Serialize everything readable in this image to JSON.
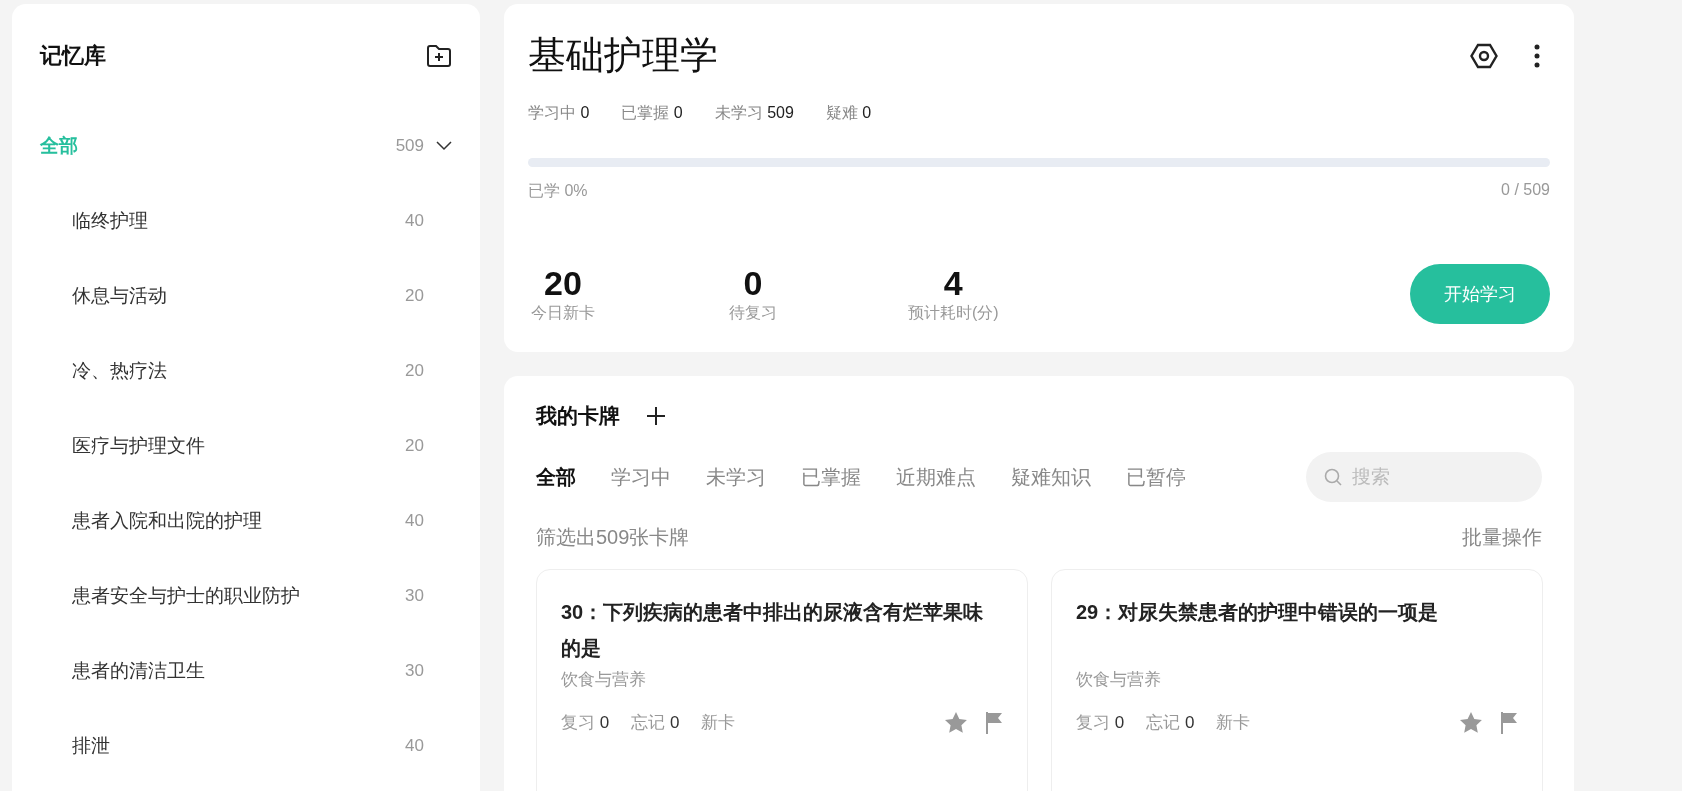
{
  "sidebar": {
    "title": "记忆库",
    "root": {
      "label": "全部",
      "count": "509",
      "selected": true,
      "expanded": true,
      "children": [
        {
          "label": "临终护理",
          "count": "40",
          "selected": false
        },
        {
          "label": "休息与活动",
          "count": "20",
          "selected": false
        },
        {
          "label": "冷、热疗法",
          "count": "20",
          "selected": false
        },
        {
          "label": "医疗与护理文件",
          "count": "20",
          "selected": false
        },
        {
          "label": "患者入院和出院的护理",
          "count": "40",
          "selected": false
        },
        {
          "label": "患者安全与护士的职业防护",
          "count": "30",
          "selected": false
        },
        {
          "label": "患者的清洁卫生",
          "count": "30",
          "selected": false
        },
        {
          "label": "排泄",
          "count": "40",
          "selected": false
        }
      ]
    }
  },
  "deck": {
    "title": "基础护理学",
    "stats": [
      {
        "label": "学习中",
        "value": "0"
      },
      {
        "label": "已掌握",
        "value": "0"
      },
      {
        "label": "未学习",
        "value": "509"
      },
      {
        "label": "疑难",
        "value": "0"
      }
    ],
    "progress": {
      "level": 0,
      "label": "已学 0%",
      "reading": "0 / 509"
    },
    "summary": [
      {
        "value": "20",
        "label": "今日新卡"
      },
      {
        "value": "0",
        "label": "待复习"
      },
      {
        "value": "4",
        "label": "预计耗时(分)"
      }
    ],
    "start_button": "开始学习"
  },
  "cards_panel": {
    "title": "我的卡牌",
    "tabs": [
      {
        "label": "全部",
        "selected": true
      },
      {
        "label": "学习中",
        "selected": false
      },
      {
        "label": "未学习",
        "selected": false
      },
      {
        "label": "已掌握",
        "selected": false
      },
      {
        "label": "近期难点",
        "selected": false
      },
      {
        "label": "疑难知识",
        "selected": false
      },
      {
        "label": "已暂停",
        "selected": false
      }
    ],
    "search": {
      "placeholder": "搜索"
    },
    "filter_text": "筛选出509张卡牌",
    "batch_link": "批量操作",
    "cards": [
      {
        "title": "30：下列疾病的患者中排出的尿液含有烂苹果味的是",
        "category": "饮食与营养",
        "stats": [
          {
            "label": "复习",
            "value": "0"
          },
          {
            "label": "忘记",
            "value": "0"
          }
        ],
        "status": "新卡"
      },
      {
        "title": "29：对尿失禁患者的护理中错误的一项是",
        "category": "饮食与营养",
        "stats": [
          {
            "label": "复习",
            "value": "0"
          },
          {
            "label": "忘记",
            "value": "0"
          }
        ],
        "status": "新卡"
      }
    ]
  }
}
